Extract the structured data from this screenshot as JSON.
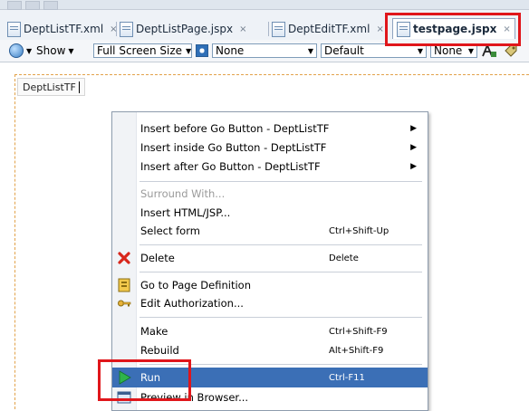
{
  "tabs": [
    {
      "label": "DeptListTF.xml",
      "close": "×"
    },
    {
      "label": "DeptListPage.jspx",
      "close": "×"
    },
    {
      "label": "DeptEditTF.xml",
      "close": "×"
    },
    {
      "label": "testpage.jspx",
      "close": "×",
      "active": true
    }
  ],
  "toolbar": {
    "show_label": "Show",
    "show_arrow": "▼",
    "size_combo": "Full Screen Size",
    "none_combo": "None",
    "default_combo": "Default",
    "none2_combo": "None",
    "arrow": "▼"
  },
  "canvas": {
    "component_label": "DeptListTF"
  },
  "menu": {
    "items": [
      {
        "label": "Insert before Go Button - DeptListTF",
        "submenu": "▶"
      },
      {
        "label": "Insert inside Go Button - DeptListTF",
        "submenu": "▶"
      },
      {
        "label": "Insert after Go Button - DeptListTF",
        "submenu": "▶"
      },
      {
        "label": "Surround With...",
        "disabled": true
      },
      {
        "label": "Insert HTML/JSP..."
      },
      {
        "label": "Select form",
        "shortcut": "Ctrl+Shift-Up"
      },
      {
        "label": "Delete",
        "shortcut": "Delete",
        "icon": "delete-x-icon"
      },
      {
        "label": "Go to Page Definition",
        "icon": "page-definition-icon"
      },
      {
        "label": "Edit Authorization...",
        "icon": "key-icon"
      },
      {
        "label": "Make",
        "shortcut": "Ctrl+Shift-F9"
      },
      {
        "label": "Rebuild",
        "shortcut": "Alt+Shift-F9"
      },
      {
        "label": "Run",
        "shortcut": "Ctrl-F11",
        "icon": "run-play-icon",
        "highlighted": true
      },
      {
        "label": "Preview in Browser...",
        "icon": "browser-icon"
      }
    ]
  },
  "colors": {
    "highlight": "#3b6fb6",
    "annotation_red": "#e0161b",
    "design_border": "#e2a24a"
  }
}
